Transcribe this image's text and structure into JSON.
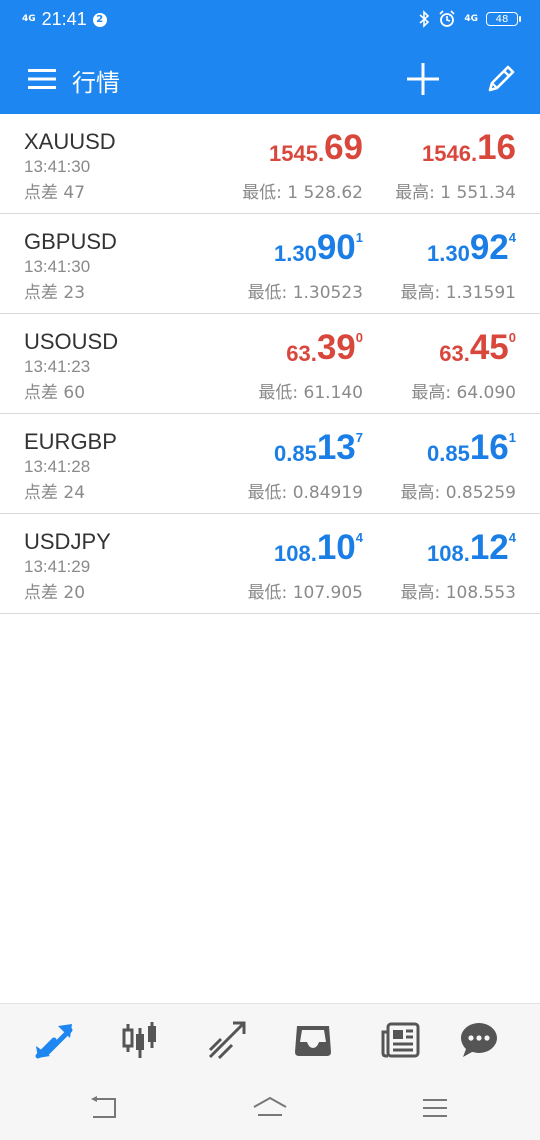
{
  "status_bar": {
    "network": "4G",
    "time": "21:41",
    "notification_count": "2",
    "right_network": "4G",
    "battery": "48",
    "icons": [
      "bluetooth-icon",
      "alarm-icon"
    ]
  },
  "app_bar": {
    "title": "行情",
    "icons": [
      "menu-icon",
      "add-icon",
      "edit-icon"
    ]
  },
  "colors": {
    "primary": "#1e86f0",
    "down": "#d9473c",
    "up": "#1a7ee6",
    "muted": "#8a8a8a"
  },
  "quotes": [
    {
      "symbol": "XAUUSD",
      "time": "13:41:30",
      "spread": "点差 47",
      "color": "red",
      "bid": {
        "small": "1545.",
        "big": "69",
        "sup": ""
      },
      "ask": {
        "small": "1546.",
        "big": "16",
        "sup": ""
      },
      "low": "最低: 1 528.62",
      "high": "最高: 1 551.34"
    },
    {
      "symbol": "GBPUSD",
      "time": "13:41:30",
      "spread": "点差 23",
      "color": "blue",
      "bid": {
        "small": "1.30",
        "big": "90",
        "sup": "1"
      },
      "ask": {
        "small": "1.30",
        "big": "92",
        "sup": "4"
      },
      "low": "最低: 1.30523",
      "high": "最高: 1.31591"
    },
    {
      "symbol": "USOUSD",
      "time": "13:41:23",
      "spread": "点差 60",
      "color": "red",
      "bid": {
        "small": "63.",
        "big": "39",
        "sup": "0"
      },
      "ask": {
        "small": "63.",
        "big": "45",
        "sup": "0"
      },
      "low": "最低: 61.140",
      "high": "最高: 64.090"
    },
    {
      "symbol": "EURGBP",
      "time": "13:41:28",
      "spread": "点差 24",
      "color": "blue",
      "bid": {
        "small": "0.85",
        "big": "13",
        "sup": "7"
      },
      "ask": {
        "small": "0.85",
        "big": "16",
        "sup": "1"
      },
      "low": "最低: 0.84919",
      "high": "最高: 0.85259"
    },
    {
      "symbol": "USDJPY",
      "time": "13:41:29",
      "spread": "点差 20",
      "color": "blue",
      "bid": {
        "small": "108.",
        "big": "10",
        "sup": "4"
      },
      "ask": {
        "small": "108.",
        "big": "12",
        "sup": "4"
      },
      "low": "最低: 107.905",
      "high": "最高: 108.553"
    }
  ],
  "bottom_nav": {
    "active": "quotes",
    "items": [
      "quotes-icon",
      "chart-candles-icon",
      "trade-icon",
      "history-inbox-icon",
      "news-icon",
      "chat-icon"
    ]
  },
  "system_nav": {
    "items": [
      "back-icon",
      "home-icon",
      "recents-icon"
    ]
  }
}
